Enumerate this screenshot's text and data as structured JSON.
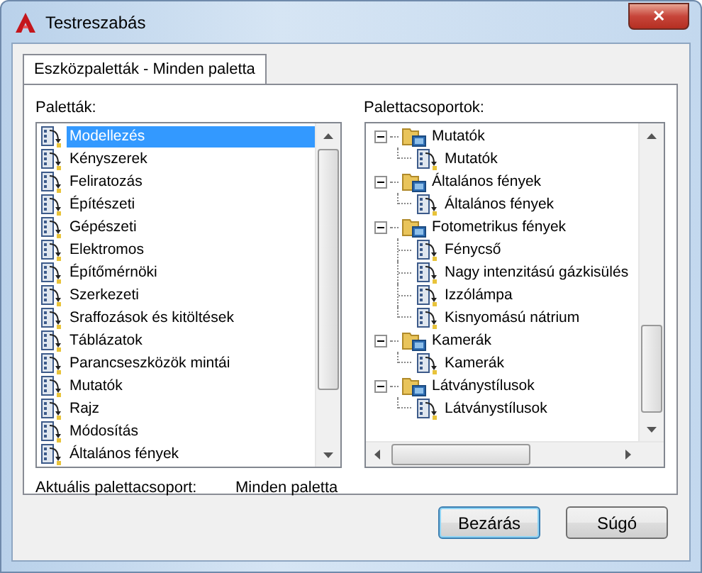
{
  "window": {
    "title": "Testreszabás",
    "close": "✕"
  },
  "tabs": [
    {
      "label": "Eszközpaletták - Minden paletta",
      "selected": true
    }
  ],
  "palettes": {
    "label": "Paletták:",
    "items": [
      {
        "label": "Modellezés",
        "selected": true
      },
      {
        "label": "Kényszerek",
        "selected": false
      },
      {
        "label": "Feliratozás",
        "selected": false
      },
      {
        "label": "Építészeti",
        "selected": false
      },
      {
        "label": "Gépészeti",
        "selected": false
      },
      {
        "label": "Elektromos",
        "selected": false
      },
      {
        "label": "Építőmérnöki",
        "selected": false
      },
      {
        "label": "Szerkezeti",
        "selected": false
      },
      {
        "label": "Sraffozások és kitöltések",
        "selected": false
      },
      {
        "label": "Táblázatok",
        "selected": false
      },
      {
        "label": "Parancseszközök mintái",
        "selected": false
      },
      {
        "label": "Mutatók",
        "selected": false
      },
      {
        "label": "Rajz",
        "selected": false
      },
      {
        "label": "Módosítás",
        "selected": false
      },
      {
        "label": "Általános fények",
        "selected": false
      }
    ]
  },
  "groups": {
    "label": "Palettacsoportok:",
    "items": [
      {
        "label": "Mutatók",
        "expanded": true,
        "children": [
          {
            "label": "Mutatók"
          }
        ]
      },
      {
        "label": "Általános fények",
        "expanded": true,
        "children": [
          {
            "label": "Általános fények"
          }
        ]
      },
      {
        "label": "Fotometrikus fények",
        "expanded": true,
        "children": [
          {
            "label": "Fénycső"
          },
          {
            "label": "Nagy intenzitású gázkisülés"
          },
          {
            "label": "Izzólámpa"
          },
          {
            "label": "Kisnyomású nátrium"
          }
        ]
      },
      {
        "label": "Kamerák",
        "expanded": true,
        "children": [
          {
            "label": "Kamerák"
          }
        ]
      },
      {
        "label": "Látványstílusok",
        "expanded": true,
        "children": [
          {
            "label": "Látványstílusok"
          }
        ]
      }
    ]
  },
  "current": {
    "label": "Aktuális palettacsoport:",
    "value": "Minden paletta"
  },
  "buttons": [
    {
      "label": "Bezárás",
      "default": true
    },
    {
      "label": "Súgó",
      "default": false
    }
  ]
}
